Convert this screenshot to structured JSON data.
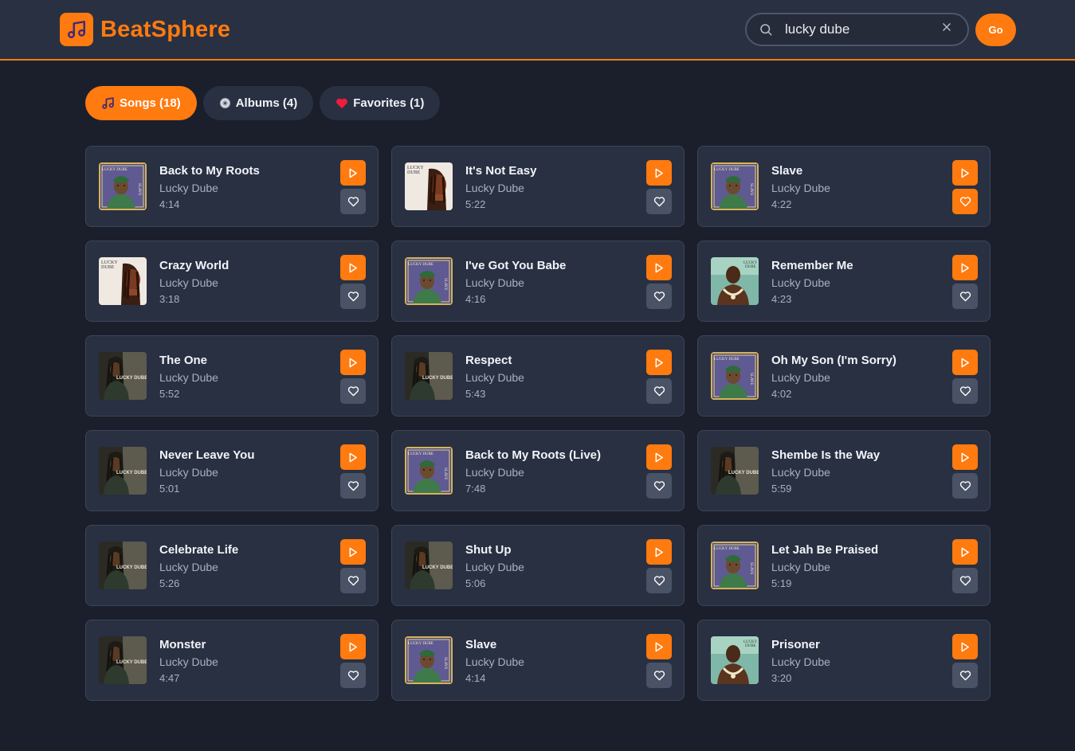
{
  "app": {
    "name": "BeatSphere",
    "logo_icon": "music-note-icon",
    "accent": "#ff7a0f",
    "background": "#1b1f2b",
    "surface": "#283042"
  },
  "search": {
    "value": "lucky dube",
    "placeholder": "",
    "button_label": "Go"
  },
  "tabs": [
    {
      "label": "Songs (18)",
      "icon": "music-note-icon",
      "active": true
    },
    {
      "label": "Albums (4)",
      "icon": "disc-icon",
      "active": false
    },
    {
      "label": "Favorites (1)",
      "icon": "heart-icon",
      "active": false
    }
  ],
  "songs": [
    {
      "title": "Back to My Roots",
      "artist": "Lucky Dube",
      "duration": "4:14",
      "cover": "slave-album-art",
      "favorite": false
    },
    {
      "title": "It's Not Easy",
      "artist": "Lucky Dube",
      "duration": "5:22",
      "cover": "portrait-album-art",
      "favorite": false
    },
    {
      "title": "Slave",
      "artist": "Lucky Dube",
      "duration": "4:22",
      "cover": "slave-album-art",
      "favorite": true
    },
    {
      "title": "Crazy World",
      "artist": "Lucky Dube",
      "duration": "3:18",
      "cover": "portrait-album-art",
      "favorite": false
    },
    {
      "title": "I've Got You Babe",
      "artist": "Lucky Dube",
      "duration": "4:16",
      "cover": "slave-album-art",
      "favorite": false
    },
    {
      "title": "Remember Me",
      "artist": "Lucky Dube",
      "duration": "4:23",
      "cover": "teal-album-art",
      "favorite": false
    },
    {
      "title": "The One",
      "artist": "Lucky Dube",
      "duration": "5:52",
      "cover": "dark-album-art",
      "favorite": false
    },
    {
      "title": "Respect",
      "artist": "Lucky Dube",
      "duration": "5:43",
      "cover": "dark-album-art",
      "favorite": false
    },
    {
      "title": "Oh My Son (I'm Sorry)",
      "artist": "Lucky Dube",
      "duration": "4:02",
      "cover": "slave-album-art",
      "favorite": false
    },
    {
      "title": "Never Leave You",
      "artist": "Lucky Dube",
      "duration": "5:01",
      "cover": "dark-album-art",
      "favorite": false
    },
    {
      "title": "Back to My Roots (Live)",
      "artist": "Lucky Dube",
      "duration": "7:48",
      "cover": "slave-album-art",
      "favorite": false
    },
    {
      "title": "Shembe Is the Way",
      "artist": "Lucky Dube",
      "duration": "5:59",
      "cover": "dark-album-art",
      "favorite": false
    },
    {
      "title": "Celebrate Life",
      "artist": "Lucky Dube",
      "duration": "5:26",
      "cover": "dark-album-art",
      "favorite": false
    },
    {
      "title": "Shut Up",
      "artist": "Lucky Dube",
      "duration": "5:06",
      "cover": "dark-album-art",
      "favorite": false
    },
    {
      "title": "Let Jah Be Praised",
      "artist": "Lucky Dube",
      "duration": "5:19",
      "cover": "slave-album-art",
      "favorite": false
    },
    {
      "title": "Monster",
      "artist": "Lucky Dube",
      "duration": "4:47",
      "cover": "dark-album-art",
      "favorite": false
    },
    {
      "title": "Slave",
      "artist": "Lucky Dube",
      "duration": "4:14",
      "cover": "slave-album-art",
      "favorite": false
    },
    {
      "title": "Prisoner",
      "artist": "Lucky Dube",
      "duration": "3:20",
      "cover": "teal-album-art",
      "favorite": false
    }
  ],
  "cover_text": {
    "slave": "LUCKY DUBE",
    "slave_side": "SLAVE",
    "portrait": "LUCKY DUBE",
    "dark": "LUCKY DUBE",
    "teal": "LUCKY DUBE"
  }
}
